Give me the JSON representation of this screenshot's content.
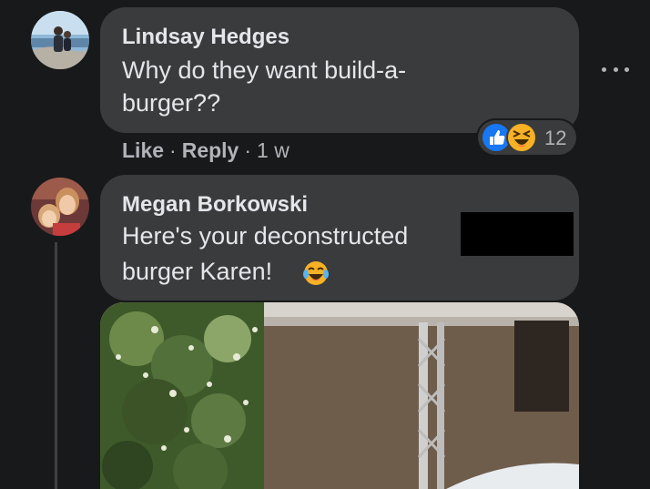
{
  "comments": [
    {
      "author": "Lindsay Hedges",
      "text_lines": [
        "Why do they want build-a-",
        "burger??"
      ],
      "actions": {
        "like": "Like",
        "reply": "Reply",
        "time": "1 w"
      },
      "reactions": {
        "icons": [
          "like-reaction",
          "haha-reaction"
        ],
        "count": "12"
      }
    },
    {
      "author": "Megan Borkowski",
      "text_lines": [
        "Here's your deconstructed",
        "burger Karen!"
      ],
      "emoji": "laughing-tears-emoji",
      "attachment": "photo"
    }
  ],
  "menu_icon": "more-options-icon",
  "colors": {
    "background": "#18191a",
    "bubble": "#3a3b3c",
    "text": "#e4e6eb",
    "secondary": "#b0b3b8",
    "like_blue": "#1877f2",
    "haha_yellow": "#f7b125"
  }
}
